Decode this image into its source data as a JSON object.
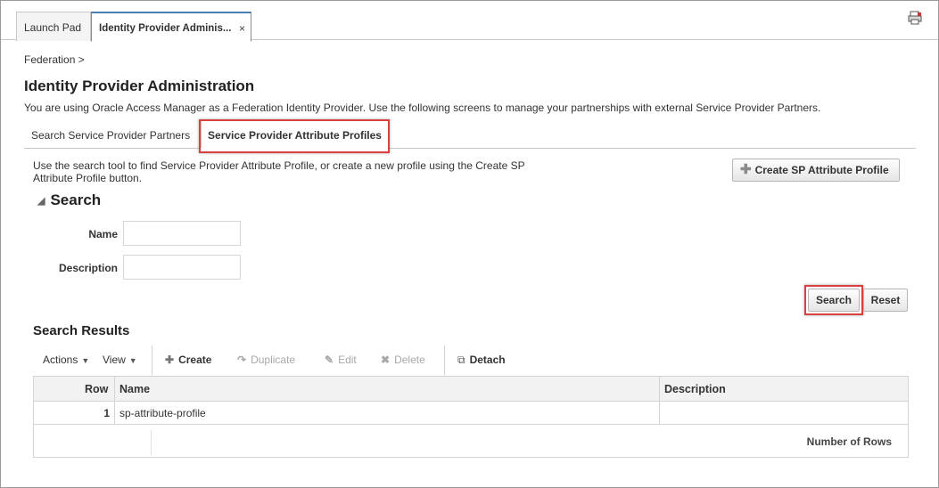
{
  "tabs": {
    "launch_pad": "Launch Pad",
    "idp_admin": "Identity Provider Adminis...",
    "close": "×"
  },
  "breadcrumb": "Federation >",
  "page": {
    "title": "Identity Provider Administration",
    "description": "You are using Oracle Access Manager as a Federation Identity Provider. Use the following screens to manage your partnerships with external Service Provider Partners."
  },
  "subtabs": {
    "search_partners": "Search Service Provider Partners",
    "attribute_profiles": "Service Provider Attribute Profiles"
  },
  "help_text": "Use the search tool to find Service Provider Attribute Profile, or create a new profile using the Create SP Attribute Profile button.",
  "create_sp_button": "Create SP Attribute Profile",
  "search": {
    "title": "Search",
    "name_label": "Name",
    "name_value": "",
    "description_label": "Description",
    "description_value": "",
    "search_button": "Search",
    "reset_button": "Reset"
  },
  "results": {
    "title": "Search Results",
    "toolbar": {
      "actions": "Actions",
      "view": "View",
      "create": "Create",
      "duplicate": "Duplicate",
      "edit": "Edit",
      "delete": "Delete",
      "detach": "Detach"
    },
    "columns": {
      "row": "Row",
      "name": "Name",
      "description": "Description"
    },
    "rows": [
      {
        "row": "1",
        "name": "sp-attribute-profile",
        "description": ""
      }
    ],
    "footer_label": "Number of Rows"
  },
  "colors": {
    "highlight": "#d9413e",
    "active_tab_accent": "#4a7db8",
    "disabled_text": "#a8a8a8"
  }
}
